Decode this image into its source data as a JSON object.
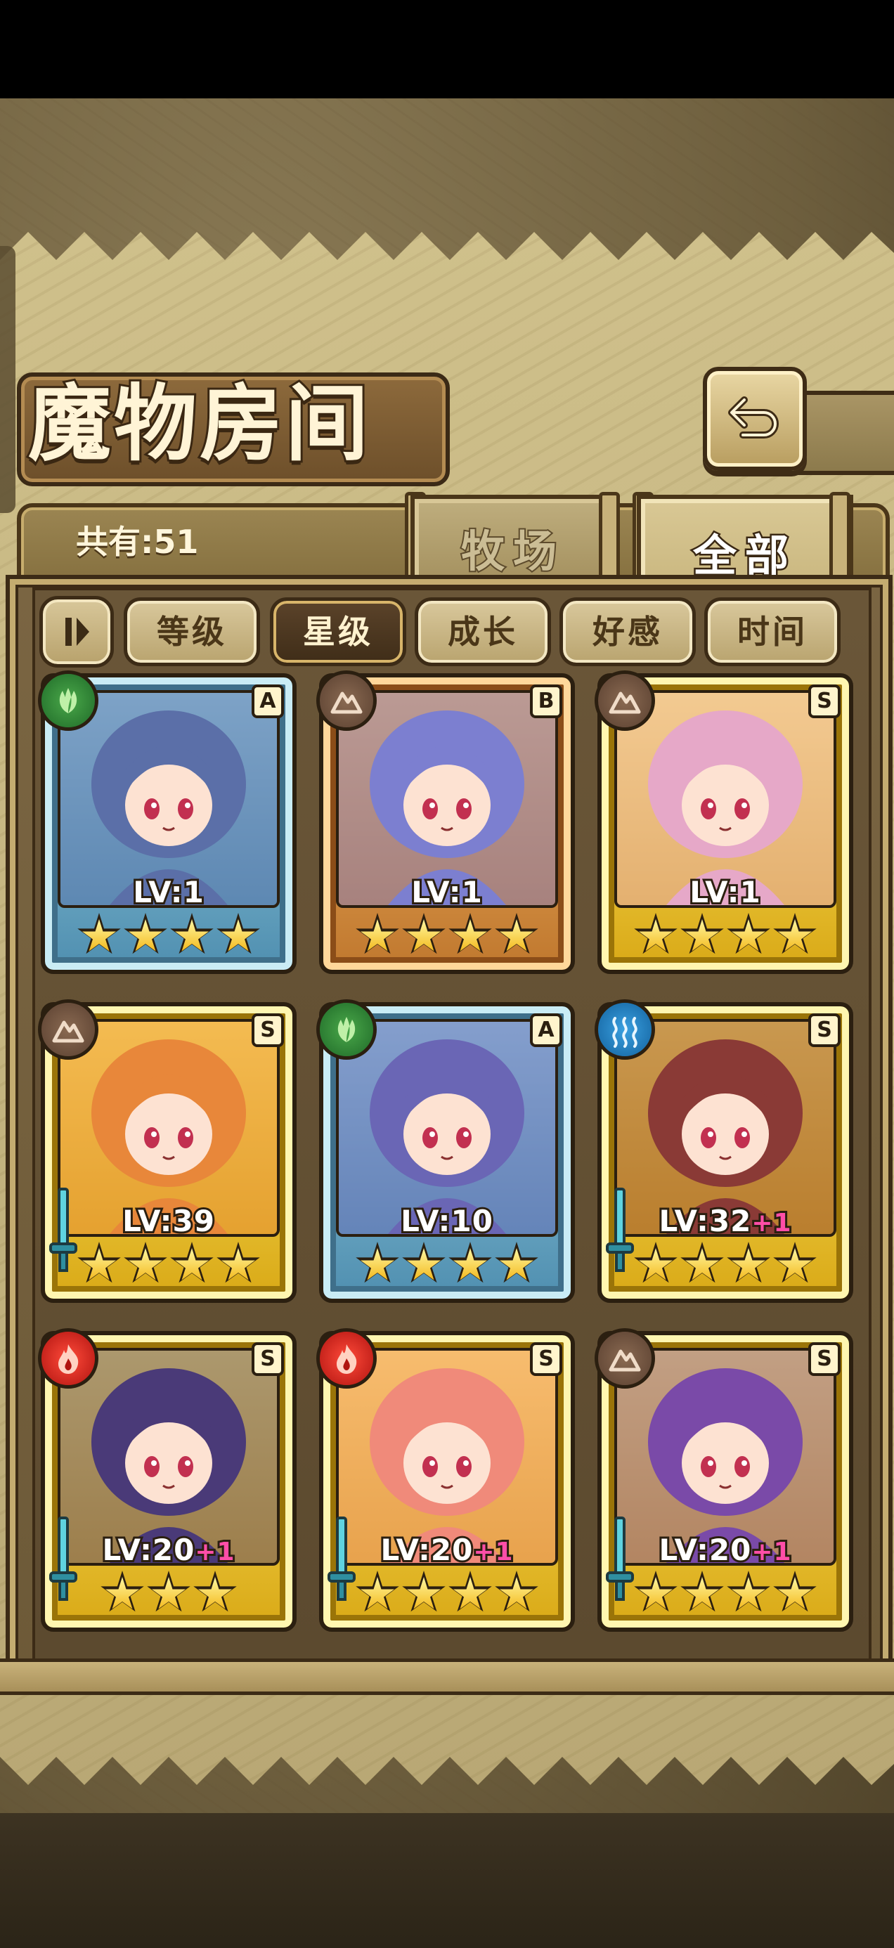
{
  "title": "魔物房间",
  "count_label": "共有:51",
  "tabs": [
    {
      "label": "牧场",
      "active": false
    },
    {
      "label": "全部",
      "active": true
    }
  ],
  "sort_buttons": [
    {
      "label": "等级",
      "active": false
    },
    {
      "label": "星级",
      "active": true
    },
    {
      "label": "成长",
      "active": false
    },
    {
      "label": "好感",
      "active": false
    },
    {
      "label": "时间",
      "active": false
    }
  ],
  "icons": {
    "back": "return-arrow-icon",
    "sort_toggle": "sort-order-icon"
  },
  "monsters": [
    {
      "rank": "A",
      "element": "nature",
      "level": "LV:1",
      "bonus": "",
      "stars": 4,
      "has_sword": false,
      "color": "#5b6fa8"
    },
    {
      "rank": "B",
      "element": "earth",
      "level": "LV:1",
      "bonus": "",
      "stars": 4,
      "has_sword": false,
      "color": "#7c7fd0"
    },
    {
      "rank": "S",
      "element": "earth",
      "level": "LV:1",
      "bonus": "",
      "stars": 4,
      "has_sword": false,
      "color": "#e6a8c8"
    },
    {
      "rank": "S",
      "element": "earth",
      "level": "LV:39",
      "bonus": "",
      "stars": 4,
      "has_sword": true,
      "color": "#e8873a"
    },
    {
      "rank": "A",
      "element": "nature",
      "level": "LV:10",
      "bonus": "",
      "stars": 4,
      "has_sword": false,
      "color": "#6a66b5"
    },
    {
      "rank": "S",
      "element": "water",
      "level": "LV:32",
      "bonus": "+1",
      "stars": 4,
      "has_sword": true,
      "color": "#8a3a36"
    },
    {
      "rank": "S",
      "element": "fire",
      "level": "LV:20",
      "bonus": "+1",
      "stars": 3,
      "has_sword": true,
      "color": "#4a3a78"
    },
    {
      "rank": "S",
      "element": "fire",
      "level": "LV:20",
      "bonus": "+1",
      "stars": 4,
      "has_sword": true,
      "color": "#f08a7a"
    },
    {
      "rank": "S",
      "element": "earth",
      "level": "LV:20",
      "bonus": "+1",
      "stars": 4,
      "has_sword": true,
      "color": "#7a4aa8"
    }
  ]
}
